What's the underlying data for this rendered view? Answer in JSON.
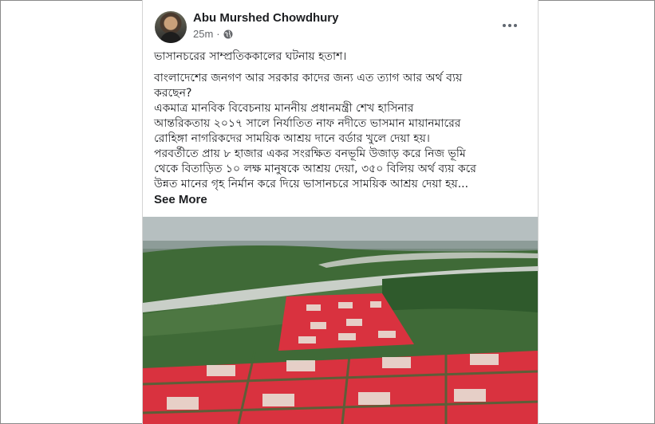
{
  "post": {
    "author": "Abu Murshed Chowdhury",
    "time": "25m",
    "separator": "·",
    "privacy_icon": "globe-icon",
    "more_icon": "more-options-icon",
    "lines": [
      "ভাসানচরের সাম্প্রতিককালের ঘটনায় হতাশ।",
      "",
      "বাংলাদেশের জনগণ আর সরকার কাদের জন্য এত  ত্যাগ আর অর্থ ব্যয়",
      "করছেন?",
      "একমাত্র  মানবিক বিবেচনায় মাননীয় প্রধানমন্ত্রী শেখ হাসিনার",
      "আন্তরিকতায় ২০১৭ সালে  নির্যাতিত নাফ নদীতে ভাসমান  মায়ানমারের",
      "রোহিঙ্গা নাগরিকদের  সাময়িক আশ্রয় দানে বর্ডার খুলে দেয়া হয়।",
      "পরবর্তীতে প্রায়  ৮ হাজার  একর সংরক্ষিত  বনভূমি উজাড় করে নিজ ভূমি",
      "থেকে বিতাড়িত  ১০ লক্ষ মানুষকে আশ্রয় দেয়া,  ৩৫০ বিলিয় অর্থ ব্যয় করে",
      "উন্নত মানের গৃহ নির্মান করে দিয়ে ভাসানচরে সাময়িক আশ্রয় দেয়া হয়..."
    ],
    "see_more": "See More"
  },
  "colors": {
    "roof_red": "#d9323f",
    "forest_green": "#3d6a36",
    "text": "#1c1e21",
    "meta": "#65676b"
  }
}
